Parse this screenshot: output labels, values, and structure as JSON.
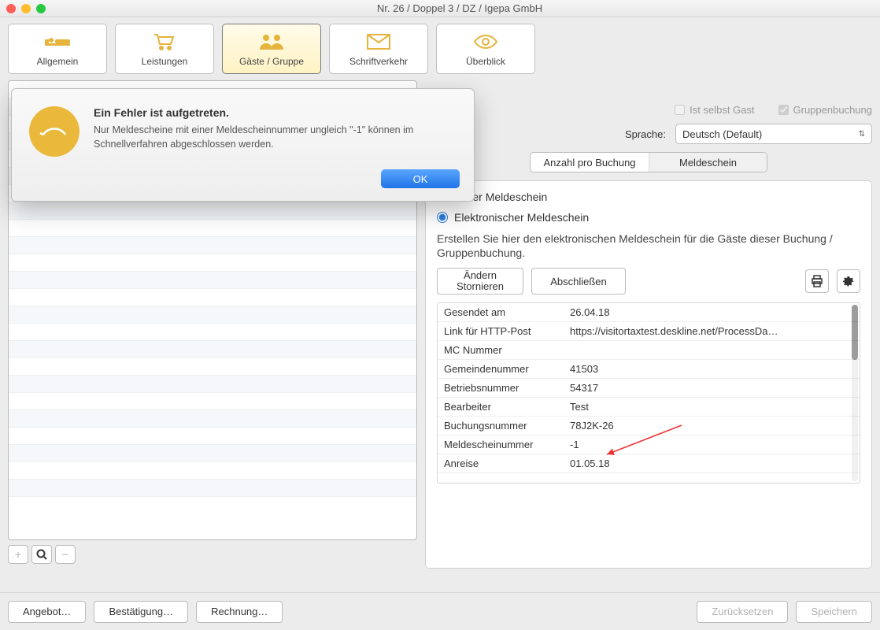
{
  "window": {
    "title": "Nr. 26 / Doppel 3 / DZ / Igepa GmbH"
  },
  "toolbar": {
    "allgemein": "Allgemein",
    "leistungen": "Leistungen",
    "gaeste": "Gäste / Gruppe",
    "schrift": "Schriftverkehr",
    "ueberblick": "Überblick"
  },
  "checks": {
    "ist_selbst_gast": "Ist selbst Gast",
    "gruppenbuchung": "Gruppenbuchung"
  },
  "language": {
    "label": "Sprache:",
    "value": "Deutsch (Default)"
  },
  "tabs": {
    "anzahl": "Anzahl pro Buchung",
    "meldeschein": "Meldeschein"
  },
  "radios": {
    "einfach": "infacher Meldeschein",
    "elektron": "Elektronischer Meldeschein"
  },
  "meld_desc": "Erstellen Sie hier den elektronischen Meldeschein für die Gäste dieser Buchung / Gruppenbuchung.",
  "buttons": {
    "aendern": "Ändern Stornieren",
    "abschliessen": "Abschließen"
  },
  "kv": [
    {
      "k": "Gesendet am",
      "v": "26.04.18"
    },
    {
      "k": "Link für HTTP-Post",
      "v": "https://visitortaxtest.deskline.net/ProcessDa…"
    },
    {
      "k": "MC Nummer",
      "v": ""
    },
    {
      "k": "Gemeindenummer",
      "v": "41503"
    },
    {
      "k": "Betriebsnummer",
      "v": "54317"
    },
    {
      "k": "Bearbeiter",
      "v": "Test"
    },
    {
      "k": "Buchungsnummer",
      "v": "78J2K-26"
    },
    {
      "k": "Meldescheinummer",
      "v": "-1"
    },
    {
      "k": "Anreise",
      "v": "01.05.18"
    }
  ],
  "footer": {
    "angebot": "Angebot…",
    "bestaetigung": "Bestätigung…",
    "rechnung": "Rechnung…",
    "zuruecksetzen": "Zurücksetzen",
    "speichern": "Speichern"
  },
  "dialog": {
    "title": "Ein Fehler ist aufgetreten.",
    "body": "Nur Meldescheine mit einer Meldescheinnummer ungleich \"-1\" können im Schnellverfahren abgeschlossen werden.",
    "ok": "OK"
  },
  "left_ctrl": {
    "plus": "+",
    "minus": "−"
  }
}
